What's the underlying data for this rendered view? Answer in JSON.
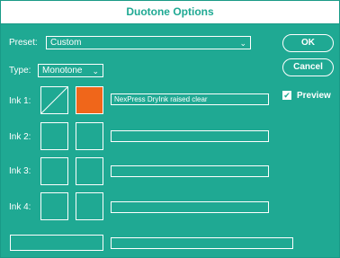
{
  "window": {
    "title": "Duotone Options"
  },
  "preset": {
    "label": "Preset:",
    "value": "Custom"
  },
  "type": {
    "label": "Type:",
    "value": "Monotone"
  },
  "buttons": {
    "ok": "OK",
    "cancel": "Cancel"
  },
  "preview": {
    "label": "Preview",
    "checked": true,
    "check_glyph": "✔"
  },
  "icons": {
    "dropdown": "chevron-down-icon",
    "check": "check-icon"
  },
  "colors": {
    "background": "#1fa993",
    "text": "#ffffff",
    "ink1_color": "#f0661a"
  },
  "inks": [
    {
      "label": "Ink 1:",
      "name": "NexPress DryInk raised clear"
    },
    {
      "label": "Ink 2:",
      "name": ""
    },
    {
      "label": "Ink 3:",
      "name": ""
    },
    {
      "label": "Ink 4:",
      "name": ""
    }
  ],
  "overprint": {
    "field_value": ""
  }
}
